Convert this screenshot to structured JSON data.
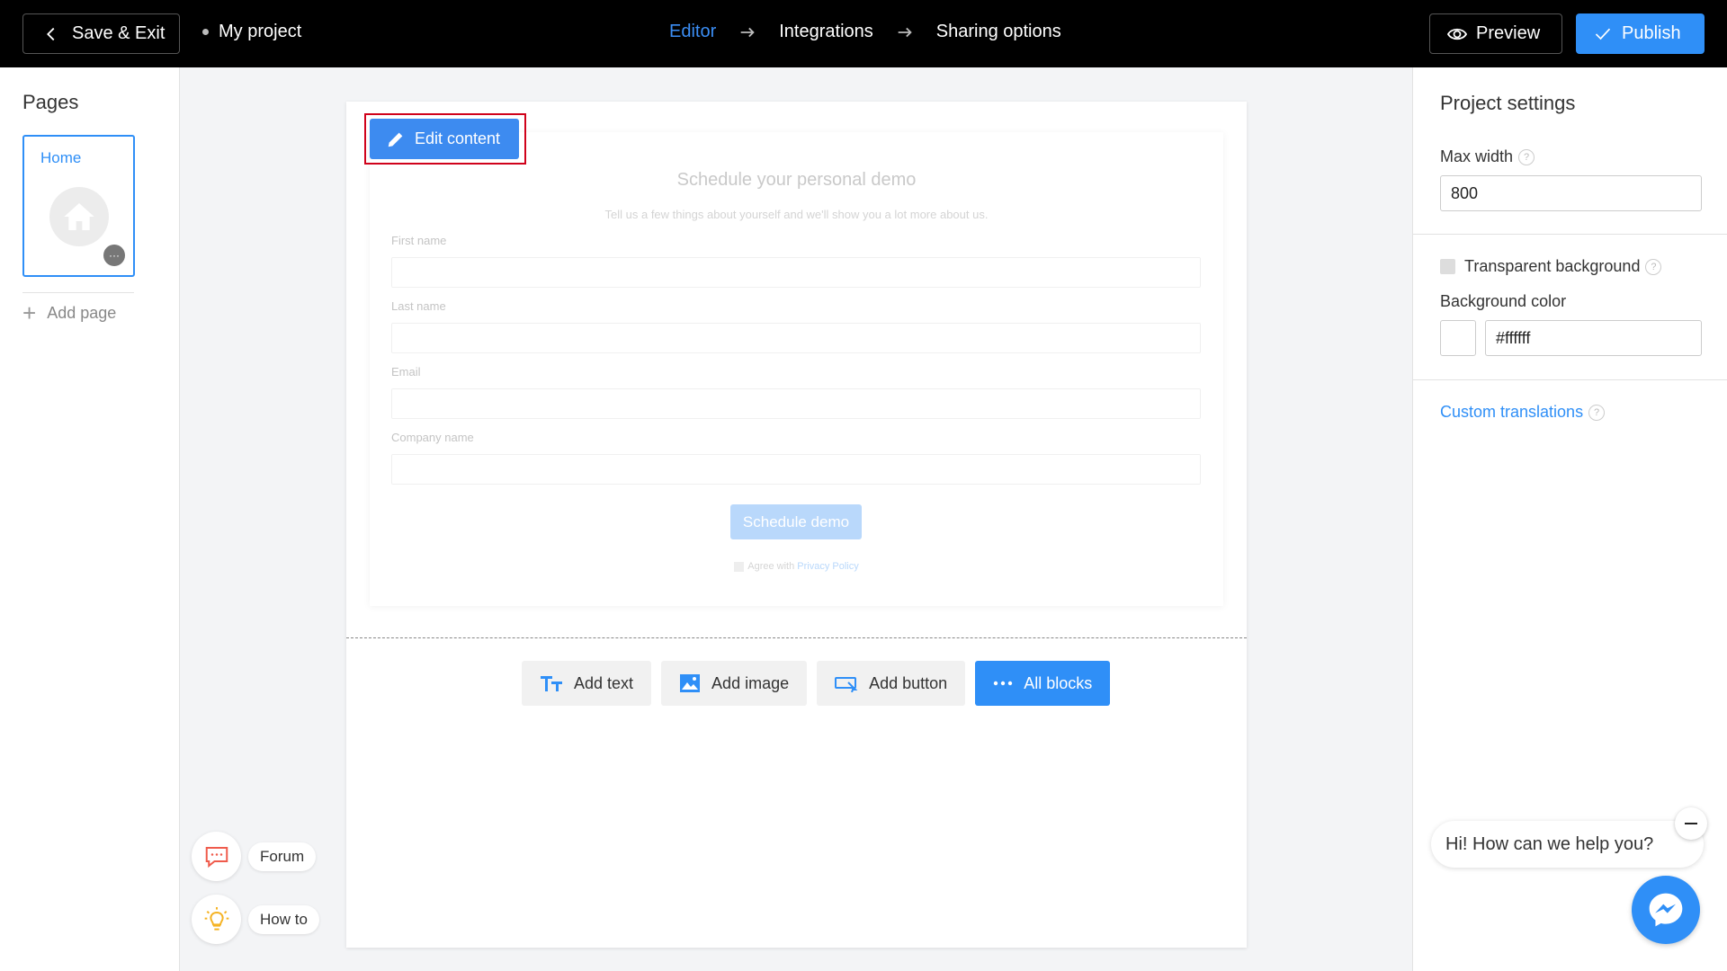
{
  "topbar": {
    "save_exit_label": "Save & Exit",
    "project_name": "My project",
    "steps": [
      "Editor",
      "Integrations",
      "Sharing options"
    ],
    "active_step": "Editor",
    "preview_label": "Preview",
    "publish_label": "Publish"
  },
  "left_sidebar": {
    "title": "Pages",
    "pages": [
      {
        "name": "Home",
        "icon": "home-icon"
      }
    ],
    "add_page_label": "Add page",
    "help": [
      {
        "label": "Forum",
        "icon": "chat-icon"
      },
      {
        "label": "How to",
        "icon": "lightbulb-icon"
      }
    ]
  },
  "canvas": {
    "edit_content_label": "Edit content",
    "form": {
      "title": "Schedule your personal demo",
      "subtitle": "Tell us a few things about yourself and we'll show you a lot more about us.",
      "fields": [
        {
          "label": "First name"
        },
        {
          "label": "Last name"
        },
        {
          "label": "Email"
        },
        {
          "label": "Company name"
        }
      ],
      "submit_label": "Schedule demo",
      "agree_prefix": "Agree with",
      "agree_link": "Privacy Policy"
    },
    "blocks": [
      {
        "label": "Add text",
        "icon": "text-icon"
      },
      {
        "label": "Add image",
        "icon": "image-icon"
      },
      {
        "label": "Add button",
        "icon": "button-icon"
      },
      {
        "label": "All blocks",
        "icon": "more-icon"
      }
    ]
  },
  "right_sidebar": {
    "title": "Project settings",
    "max_width_label": "Max width",
    "max_width_value": "800",
    "transparent_bg_label": "Transparent background",
    "transparent_bg_checked": false,
    "bg_color_label": "Background color",
    "bg_color_value": "#ffffff",
    "custom_translations_label": "Custom translations"
  },
  "chat": {
    "greeting": "Hi! How can we help you?"
  },
  "colors": {
    "accent": "#2f8ff7",
    "highlight": "#d0021b"
  }
}
